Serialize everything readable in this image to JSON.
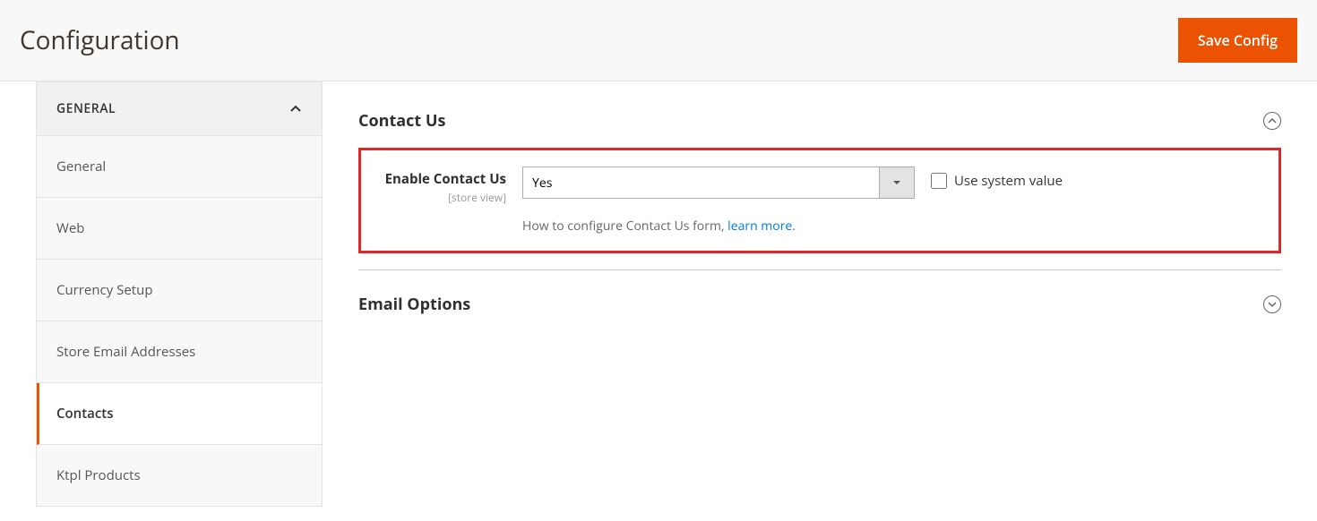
{
  "header": {
    "title": "Configuration",
    "save_button": "Save Config"
  },
  "sidebar": {
    "section_title": "GENERAL",
    "items": [
      {
        "label": "General",
        "active": false
      },
      {
        "label": "Web",
        "active": false
      },
      {
        "label": "Currency Setup",
        "active": false
      },
      {
        "label": "Store Email Addresses",
        "active": false
      },
      {
        "label": "Contacts",
        "active": true
      },
      {
        "label": "Ktpl Products",
        "active": false
      }
    ]
  },
  "main": {
    "sections": {
      "contact_us": {
        "title": "Contact Us",
        "expanded": true,
        "field": {
          "label": "Enable Contact Us",
          "scope": "[store view]",
          "value": "Yes",
          "use_system_label": "Use system value",
          "note_prefix": "How to configure Contact Us form, ",
          "note_link": "learn more",
          "note_suffix": "."
        }
      },
      "email_options": {
        "title": "Email Options",
        "expanded": false
      }
    }
  }
}
